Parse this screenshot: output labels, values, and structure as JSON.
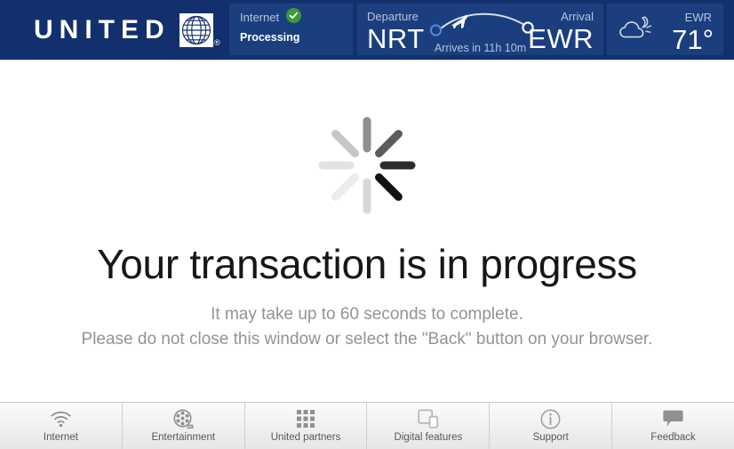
{
  "brand": {
    "name": "UNITED",
    "logo_icon": "united-globe-icon",
    "registered_mark": "®",
    "header_bg": "#12306e",
    "panel_bg": "#1b3f7e"
  },
  "header": {
    "internet": {
      "label": "Internet",
      "status": "Processing",
      "status_icon": "green-check-icon",
      "status_color": "#3c9a36"
    },
    "flight": {
      "departure_label": "Departure",
      "departure_code": "NRT",
      "arrival_label": "Arrival",
      "arrival_code": "EWR",
      "eta": "Arrives in 11h 10m",
      "route_icon": "flight-arc-icon",
      "plane_icon": "airplane-icon"
    },
    "weather": {
      "icon": "night-partly-cloudy-icon",
      "station": "EWR",
      "temperature": "71°"
    }
  },
  "main": {
    "spinner_icon": "loading-spinner-icon",
    "headline": "Your transaction is in progress",
    "subtext_line1": "It may take up to 60 seconds to complete.",
    "subtext_line2": "Please do not close this window or select the \"Back\" button on your browser."
  },
  "navbar": {
    "items": [
      {
        "label": "Internet",
        "icon": "wifi-icon"
      },
      {
        "label": "Entertainment",
        "icon": "film-reel-icon"
      },
      {
        "label": "United partners",
        "icon": "grid-apps-icon"
      },
      {
        "label": "Digital features",
        "icon": "devices-icon"
      },
      {
        "label": "Support",
        "icon": "info-circle-icon"
      },
      {
        "label": "Feedback",
        "icon": "speech-bubble-icon"
      }
    ]
  }
}
